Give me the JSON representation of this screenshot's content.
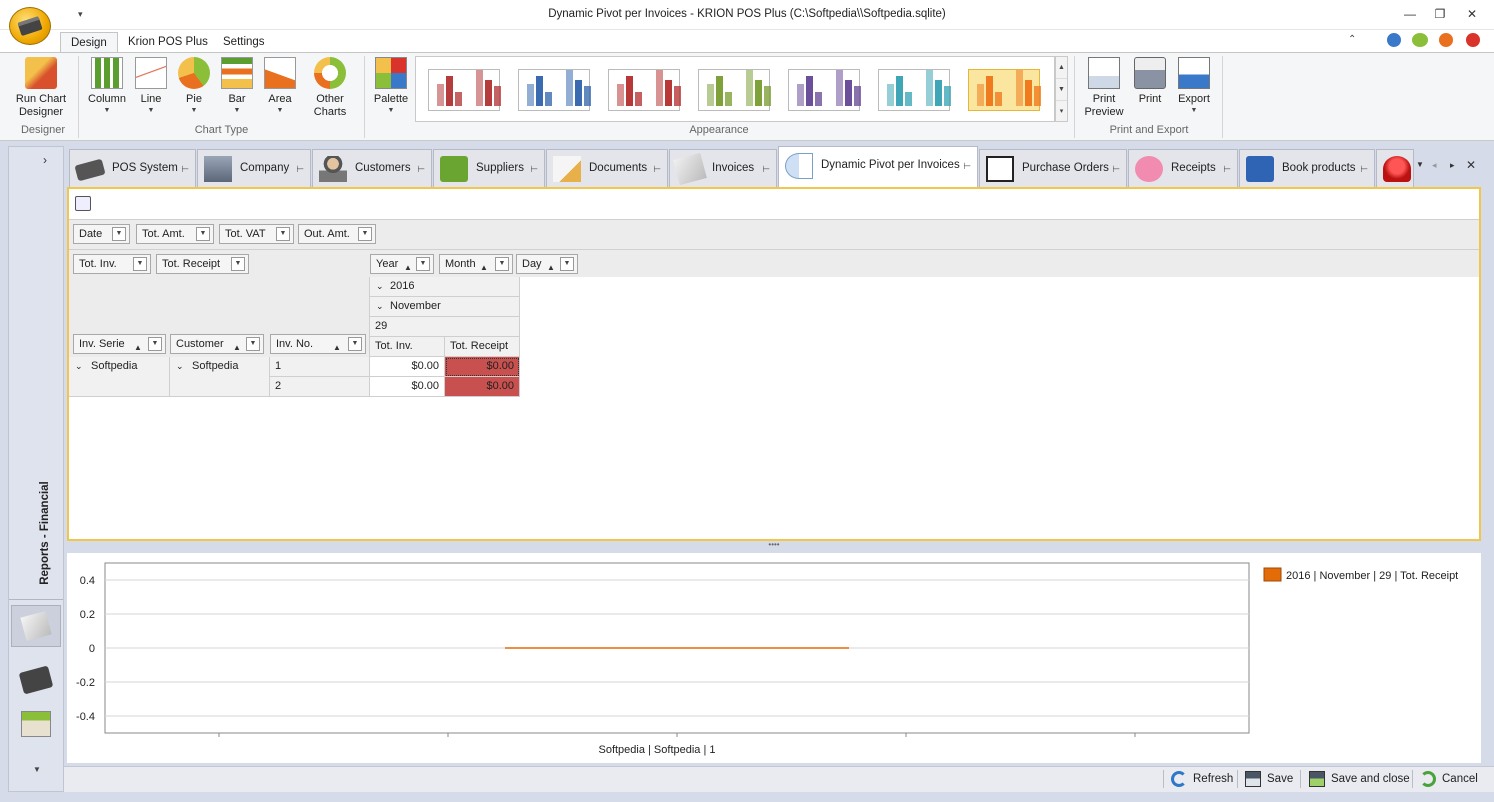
{
  "window": {
    "title": "Dynamic Pivot per Invoices - KRION POS Plus (C:\\Softpedia\\\\Softpedia.sqlite)"
  },
  "ribbon_tabs": [
    "Design",
    "Krion POS Plus",
    "Settings"
  ],
  "ribbon": {
    "designer": {
      "run_chart_designer": "Run Chart\nDesigner",
      "group": "Designer"
    },
    "chart_type": {
      "column": "Column",
      "line": "Line",
      "pie": "Pie",
      "bar": "Bar",
      "area": "Area",
      "other": "Other\nCharts",
      "group": "Chart Type"
    },
    "appearance": {
      "palette": "Palette",
      "group": "Appearance"
    },
    "print_export": {
      "print_preview": "Print\nPreview",
      "print": "Print",
      "export": "Export",
      "group": "Print and Export"
    }
  },
  "palette_colors": [
    "#b43c3c",
    "#3a6bb0",
    "#b83838",
    "#7ea13a",
    "#6b4f9a",
    "#3fa6b8",
    "#f07b1e"
  ],
  "sidebar": {
    "label": "Reports - Financial"
  },
  "doc_tabs": [
    "POS System",
    "Company",
    "Customers",
    "Suppliers",
    "Documents",
    "Invoices",
    "Dynamic Pivot per Invoices",
    "Purchase Orders",
    "Receipts",
    "Book products"
  ],
  "pivot": {
    "filter_fields": [
      "Date",
      "Tot. Amt.",
      "Tot. VAT",
      "Out. Amt."
    ],
    "data_fields": [
      "Tot. Inv.",
      "Tot. Receipt"
    ],
    "column_fields": [
      "Year",
      "Month",
      "Day"
    ],
    "row_fields": [
      "Inv. Serie",
      "Customer",
      "Inv. No."
    ],
    "year": "2016",
    "month": "November",
    "day": "29",
    "measure_headers": [
      "Tot. Inv.",
      "Tot. Receipt"
    ],
    "rows": [
      {
        "serie": "Softpedia",
        "customer": "Softpedia",
        "inv_no": "1",
        "tot_inv": "$0.00",
        "tot_receipt": "$0.00"
      },
      {
        "inv_no": "2",
        "tot_inv": "$0.00",
        "tot_receipt": "$0.00"
      }
    ]
  },
  "chart_data": {
    "type": "line",
    "categories": [
      "Softpedia | Softpedia | 1"
    ],
    "series": [
      {
        "name": "2016 | November | 29 | Tot. Receipt",
        "values": [
          0
        ],
        "color": "#e36c09"
      }
    ],
    "yticks": [
      0.4,
      0.2,
      0,
      -0.2,
      -0.4
    ],
    "ylim": [
      -0.5,
      0.5
    ],
    "grid": true,
    "legend": "top-right"
  },
  "status_buttons": {
    "refresh": "Refresh",
    "save": "Save",
    "save_close": "Save and close",
    "cancel": "Cancel"
  }
}
